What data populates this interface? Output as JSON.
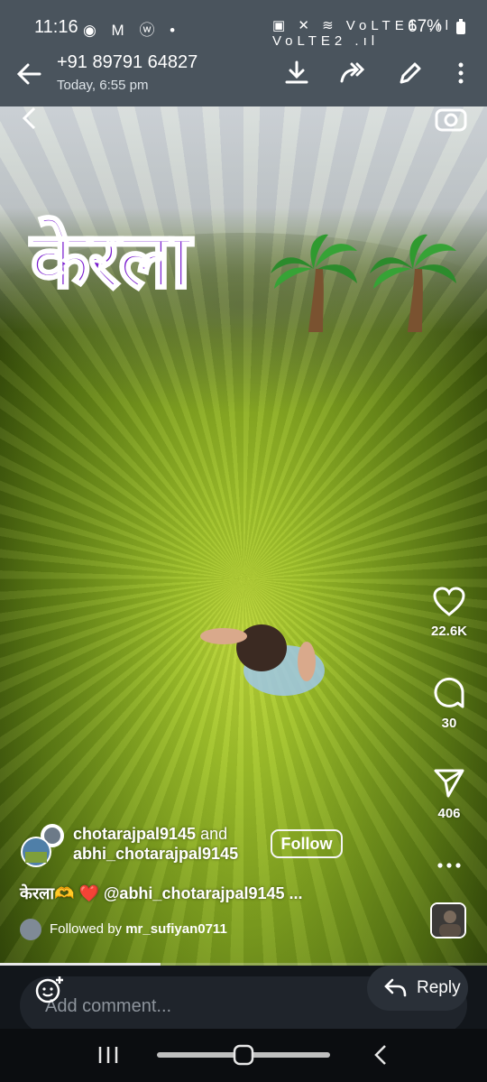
{
  "status_bar": {
    "time": "11:16",
    "left_icons": "◉ M ⓦ •",
    "right_icons": "▣ ✕ ≋ VoLTE1 .ıl VoLTE2 .ıl",
    "battery": "67%"
  },
  "header": {
    "contact_name": "+91 89791 64827",
    "timestamp": "Today, 6:55 pm"
  },
  "media": {
    "title_text": "केरला"
  },
  "actions": {
    "likes": "22.6K",
    "comments": "30",
    "shares": "406"
  },
  "author": {
    "name1": "chotarajpal9145",
    "joiner": "and",
    "name2": "abhi_chotarajpal9145",
    "follow_label": "Follow"
  },
  "caption": "केरला🫶 ❤️ @abhi_chotarajpal9145 ...",
  "followed_by": {
    "prefix": "Followed by",
    "user": "mr_sufiyan0711"
  },
  "progress": {
    "fraction": 0.33
  },
  "comment_bar": {
    "placeholder": "Add comment...",
    "reply_label": "Reply"
  },
  "colors": {
    "header_bg": "#4a545d",
    "title_purple": "#7b1fd0",
    "field_green": "#9fc12a"
  }
}
